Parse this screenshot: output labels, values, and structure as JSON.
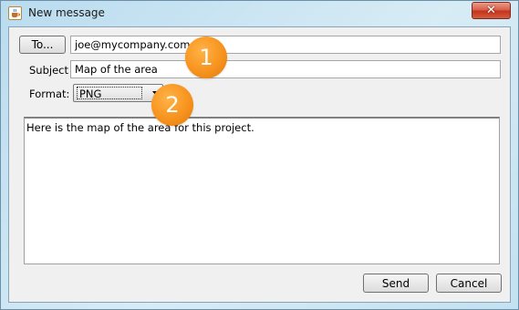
{
  "window": {
    "title": "New message",
    "close_label": "✕",
    "icon": "java-cup-icon"
  },
  "form": {
    "to_button_label": "To...",
    "to_value": "joe@mycompany.com",
    "subject_label": "Subject",
    "subject_value": "Map of the area",
    "format_label": "Format:",
    "format_selected": "PNG",
    "body_text": "Here is the map of the area for this project."
  },
  "callouts": [
    {
      "label": "1",
      "color": "#f7931e"
    },
    {
      "label": "2",
      "color": "#f7931e"
    }
  ],
  "actions": {
    "send_label": "Send",
    "cancel_label": "Cancel"
  }
}
